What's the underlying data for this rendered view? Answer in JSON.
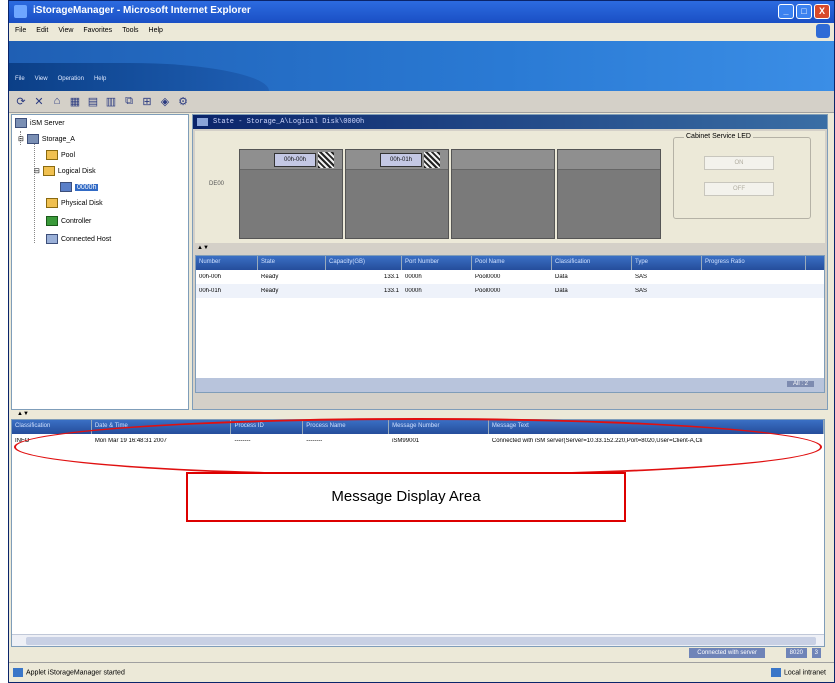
{
  "window": {
    "title": "iStorageManager - Microsoft Internet Explorer",
    "controls": [
      "_",
      "□",
      "X"
    ]
  },
  "browser_menu": [
    "File",
    "Edit",
    "View",
    "Favorites",
    "Tools",
    "Help"
  ],
  "app_menu": [
    "File",
    "View",
    "Operation",
    "Help"
  ],
  "toolbar_icons": [
    "refresh-icon",
    "delete-icon",
    "home-icon",
    "layout-icon",
    "disk-icon",
    "config-icon",
    "link-icon",
    "network-icon",
    "shield-icon",
    "settings-icon"
  ],
  "tree": {
    "root": "iSM Server",
    "storage": "Storage_A",
    "pool": "Pool",
    "logical_disk": "Logical Disk",
    "selected": "0000h",
    "physical_disk": "Physical Disk",
    "controller": "Controller",
    "connected_host": "Connected Host"
  },
  "panel": {
    "title": "State - Storage_A\\Logical Disk\\0000h",
    "disk_label": "DE00",
    "slots": [
      "00h-00h",
      "00h-01h"
    ],
    "led_title": "Cabinet Service LED",
    "led_on": "ON",
    "led_off": "OFF"
  },
  "grid": {
    "columns": [
      "Number",
      "State",
      "Capacity(GB)",
      "Port Number",
      "Pool Name",
      "Classification",
      "Type",
      "Progress Ratio"
    ],
    "rows": [
      [
        "00h-00h",
        "Ready",
        "133.1",
        "0000h",
        "Pool0000",
        "Data",
        "SAS",
        ""
      ],
      [
        "00h-01h",
        "Ready",
        "133.1",
        "0000h",
        "Pool0000",
        "Data",
        "SAS",
        ""
      ]
    ],
    "footer": "All : 2"
  },
  "messages": {
    "columns": [
      "Classification",
      "Date & Time",
      "Process ID",
      "Process Name",
      "Message Number",
      "Message Text"
    ],
    "rows": [
      [
        "INFO",
        "Mon Mar 19 16:48:31 2007",
        "--------",
        "--------",
        "iSM99001",
        "Connected with iSM server(Server=10.33.152.220,Port=8020,User=Client-A,Cli"
      ]
    ]
  },
  "app_status": {
    "connection": "Connected with server",
    "port": "8020",
    "count": "3"
  },
  "ie_status": {
    "left": "Applet iStorageManager started",
    "right": "Local intranet"
  },
  "annotation": {
    "label": "Message Display Area",
    "color": "#e01010"
  }
}
